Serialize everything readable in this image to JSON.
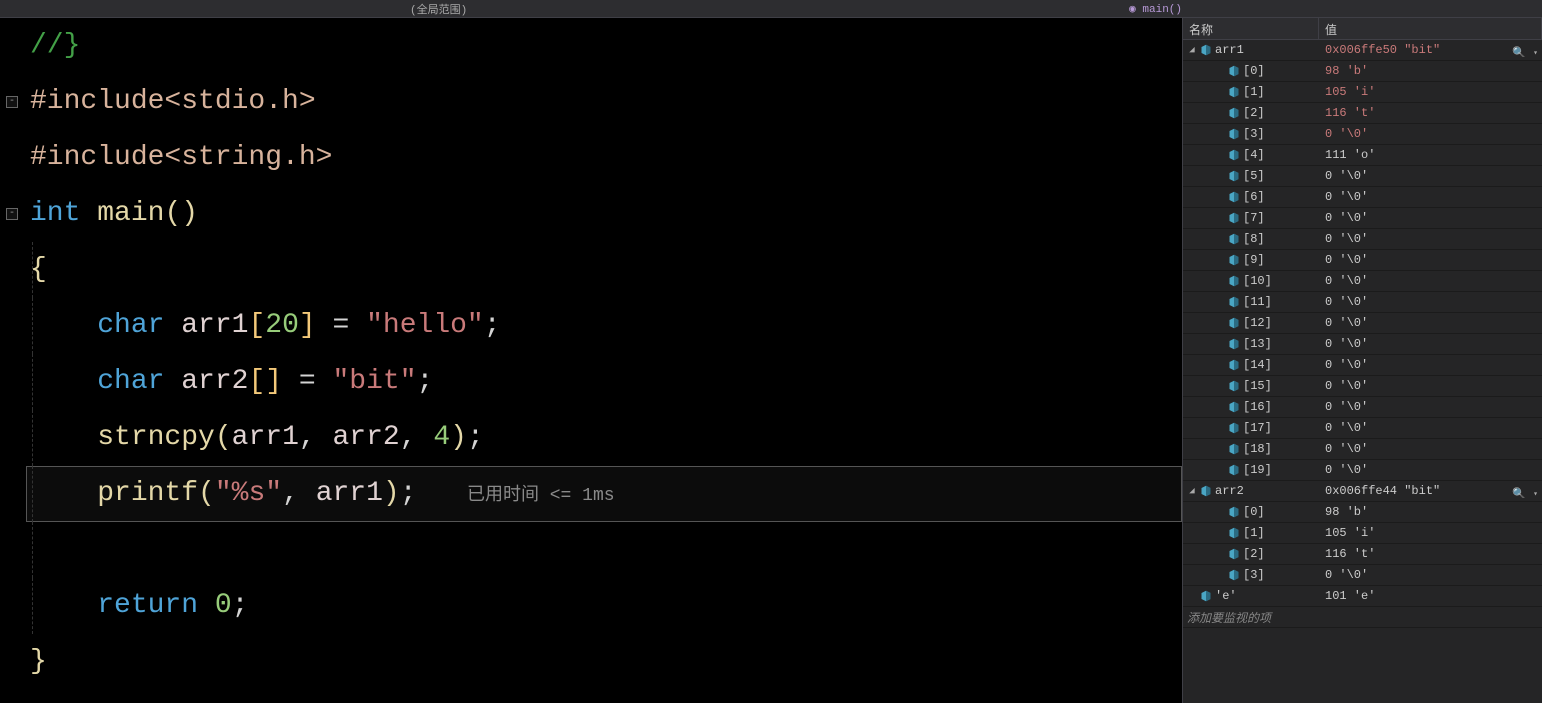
{
  "topbar": {
    "scope": "(全局范围)",
    "func": "main()"
  },
  "editor": {
    "timing_hint": "已用时间 <= 1ms",
    "lines": [
      {
        "tokens": [
          [
            "c-comment",
            "//}"
          ]
        ]
      },
      {
        "fold": true,
        "tokens": [
          [
            "c-pre",
            "#include"
          ],
          [
            "c-angle",
            "<stdio.h>"
          ]
        ]
      },
      {
        "tokens": [
          [
            "c-pre",
            "#include"
          ],
          [
            "c-angle",
            "<string.h>"
          ]
        ]
      },
      {
        "fold": true,
        "tokens": [
          [
            "c-type",
            "int "
          ],
          [
            "c-fn",
            "main"
          ],
          [
            "c-paren",
            "()"
          ]
        ]
      },
      {
        "guide": true,
        "tokens": [
          [
            "c-brace",
            "{"
          ]
        ]
      },
      {
        "guide": true,
        "tokens": [
          [
            "",
            "    "
          ],
          [
            "c-type",
            "char "
          ],
          [
            "c-ident",
            "arr1"
          ],
          [
            "c-brack",
            "["
          ],
          [
            "c-num",
            "20"
          ],
          [
            "c-brack",
            "]"
          ],
          [
            "c-punct",
            " = "
          ],
          [
            "c-str",
            "\"hello\""
          ],
          [
            "c-punct",
            ";"
          ]
        ]
      },
      {
        "guide": true,
        "tokens": [
          [
            "",
            "    "
          ],
          [
            "c-type",
            "char "
          ],
          [
            "c-ident",
            "arr2"
          ],
          [
            "c-brack",
            "["
          ],
          [
            "c-brack",
            "]"
          ],
          [
            "c-punct",
            " = "
          ],
          [
            "c-str",
            "\"bit\""
          ],
          [
            "c-punct",
            ";"
          ]
        ]
      },
      {
        "guide": true,
        "tokens": [
          [
            "",
            "    "
          ],
          [
            "c-fn",
            "strncpy"
          ],
          [
            "c-paren",
            "("
          ],
          [
            "c-ident",
            "arr1"
          ],
          [
            "c-punct",
            ", "
          ],
          [
            "c-ident",
            "arr2"
          ],
          [
            "c-punct",
            ", "
          ],
          [
            "c-num",
            "4"
          ],
          [
            "c-paren",
            ")"
          ],
          [
            "c-punct",
            ";"
          ]
        ]
      },
      {
        "guide": true,
        "current": true,
        "tokens": [
          [
            "",
            "    "
          ],
          [
            "c-fn",
            "printf"
          ],
          [
            "c-paren",
            "("
          ],
          [
            "c-str",
            "\"%s\""
          ],
          [
            "c-punct",
            ", "
          ],
          [
            "c-ident",
            "arr1"
          ],
          [
            "c-paren",
            ")"
          ],
          [
            "c-punct",
            ";"
          ],
          [
            "",
            "   "
          ],
          [
            "c-hint",
            "已用时间 <= 1ms"
          ]
        ]
      },
      {
        "guide": true,
        "tokens": [
          [
            "",
            " "
          ]
        ]
      },
      {
        "guide": true,
        "tokens": [
          [
            "",
            "    "
          ],
          [
            "c-kw",
            "return "
          ],
          [
            "c-num",
            "0"
          ],
          [
            "c-punct",
            ";"
          ]
        ]
      },
      {
        "tokens": [
          [
            "c-brace",
            "}"
          ]
        ]
      }
    ]
  },
  "watch": {
    "header": {
      "name": "名称",
      "value": "值"
    },
    "add_prompt": "添加要监视的项",
    "rows": [
      {
        "depth": 0,
        "expander": "down",
        "icon": true,
        "name": "arr1",
        "value": "0x006ffe50 \"bit\"",
        "red": true,
        "search": true
      },
      {
        "depth": 1,
        "icon": true,
        "name": "[0]",
        "value": "98 'b'",
        "red": true
      },
      {
        "depth": 1,
        "icon": true,
        "name": "[1]",
        "value": "105 'i'",
        "red": true
      },
      {
        "depth": 1,
        "icon": true,
        "name": "[2]",
        "value": "116 't'",
        "red": true
      },
      {
        "depth": 1,
        "icon": true,
        "name": "[3]",
        "value": "0 '\\0'",
        "red": true
      },
      {
        "depth": 1,
        "icon": true,
        "name": "[4]",
        "value": "111 'o'"
      },
      {
        "depth": 1,
        "icon": true,
        "name": "[5]",
        "value": "0 '\\0'"
      },
      {
        "depth": 1,
        "icon": true,
        "name": "[6]",
        "value": "0 '\\0'"
      },
      {
        "depth": 1,
        "icon": true,
        "name": "[7]",
        "value": "0 '\\0'"
      },
      {
        "depth": 1,
        "icon": true,
        "name": "[8]",
        "value": "0 '\\0'"
      },
      {
        "depth": 1,
        "icon": true,
        "name": "[9]",
        "value": "0 '\\0'"
      },
      {
        "depth": 1,
        "icon": true,
        "name": "[10]",
        "value": "0 '\\0'"
      },
      {
        "depth": 1,
        "icon": true,
        "name": "[11]",
        "value": "0 '\\0'"
      },
      {
        "depth": 1,
        "icon": true,
        "name": "[12]",
        "value": "0 '\\0'"
      },
      {
        "depth": 1,
        "icon": true,
        "name": "[13]",
        "value": "0 '\\0'"
      },
      {
        "depth": 1,
        "icon": true,
        "name": "[14]",
        "value": "0 '\\0'"
      },
      {
        "depth": 1,
        "icon": true,
        "name": "[15]",
        "value": "0 '\\0'"
      },
      {
        "depth": 1,
        "icon": true,
        "name": "[16]",
        "value": "0 '\\0'"
      },
      {
        "depth": 1,
        "icon": true,
        "name": "[17]",
        "value": "0 '\\0'"
      },
      {
        "depth": 1,
        "icon": true,
        "name": "[18]",
        "value": "0 '\\0'"
      },
      {
        "depth": 1,
        "icon": true,
        "name": "[19]",
        "value": "0 '\\0'"
      },
      {
        "depth": 0,
        "expander": "down",
        "icon": true,
        "name": "arr2",
        "value": "0x006ffe44 \"bit\"",
        "search": true
      },
      {
        "depth": 1,
        "icon": true,
        "name": "[0]",
        "value": "98 'b'"
      },
      {
        "depth": 1,
        "icon": true,
        "name": "[1]",
        "value": "105 'i'"
      },
      {
        "depth": 1,
        "icon": true,
        "name": "[2]",
        "value": "116 't'"
      },
      {
        "depth": 1,
        "icon": true,
        "name": "[3]",
        "value": "0 '\\0'"
      },
      {
        "depth": 0,
        "icon": true,
        "name": "'e'",
        "value": "101 'e'"
      }
    ]
  }
}
